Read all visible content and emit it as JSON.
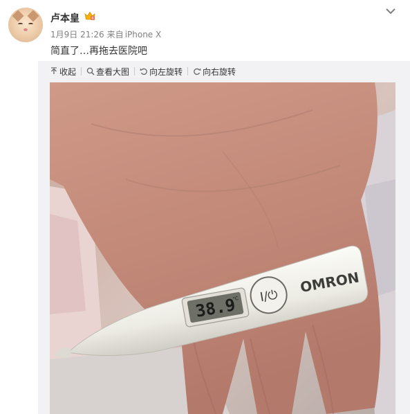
{
  "post": {
    "username": "卢本皇",
    "date": "1月9日 21:26",
    "source_prefix": "来自",
    "source_device": "iPhone X",
    "text": "简直了…再拖去医院吧"
  },
  "toolbar": {
    "collapse_label": "收起",
    "view_large_label": "查看大图",
    "rotate_left_label": "向左旋转",
    "rotate_right_label": "向右旋转"
  },
  "photo": {
    "thermometer_reading": "38.9",
    "thermometer_unit": "°C",
    "brand": "OMRON",
    "power_label": "I/⏻"
  },
  "colors": {
    "accent": "#eb7350",
    "text": "#333333",
    "muted": "#808080",
    "media_bg": "#f2f2f5"
  },
  "icons": [
    "dropdown-chevron-icon",
    "vip-crown-icon",
    "collapse-icon",
    "zoom-icon",
    "rotate-left-icon",
    "rotate-right-icon"
  ]
}
